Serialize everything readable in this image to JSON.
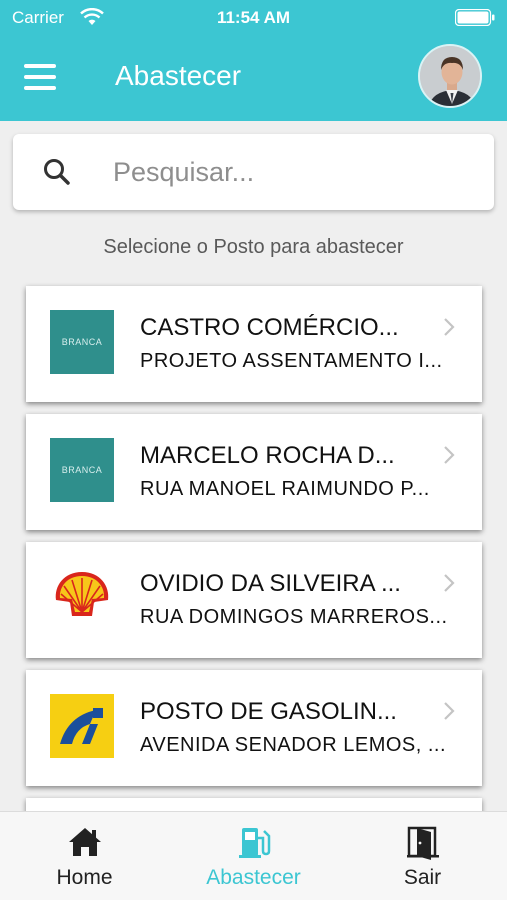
{
  "status_bar": {
    "carrier": "Carrier",
    "time": "11:54 AM"
  },
  "header": {
    "title": "Abastecer",
    "menu_icon": "hamburger-menu-icon",
    "accent_color": "#3cc6d2"
  },
  "search": {
    "placeholder": "Pesquisar...",
    "value": ""
  },
  "subtitle": "Selecione o Posto para abastecer",
  "stations": [
    {
      "name": "CASTRO COMÉRCIO...",
      "address": "PROJETO ASSENTAMENTO I...",
      "logo": "branca-logo",
      "logo_text": "BRANCA"
    },
    {
      "name": "MARCELO ROCHA D...",
      "address": "RUA MANOEL RAIMUNDO P...",
      "logo": "branca-logo",
      "logo_text": "BRANCA"
    },
    {
      "name": "OVIDIO DA SILVEIRA ...",
      "address": "RUA DOMINGOS MARREROS...",
      "logo": "shell-logo"
    },
    {
      "name": "POSTO DE GASOLIN...",
      "address": "AVENIDA SENADOR LEMOS, ...",
      "logo": "ipiranga-logo"
    }
  ],
  "tabs": [
    {
      "label": "Home",
      "icon": "home-icon",
      "active": false
    },
    {
      "label": "Abastecer",
      "icon": "fuel-pump-icon",
      "active": true
    },
    {
      "label": "Sair",
      "icon": "exit-door-icon",
      "active": false
    }
  ],
  "colors": {
    "tab_active": "#3cc6d2",
    "tab_inactive": "#222222"
  }
}
